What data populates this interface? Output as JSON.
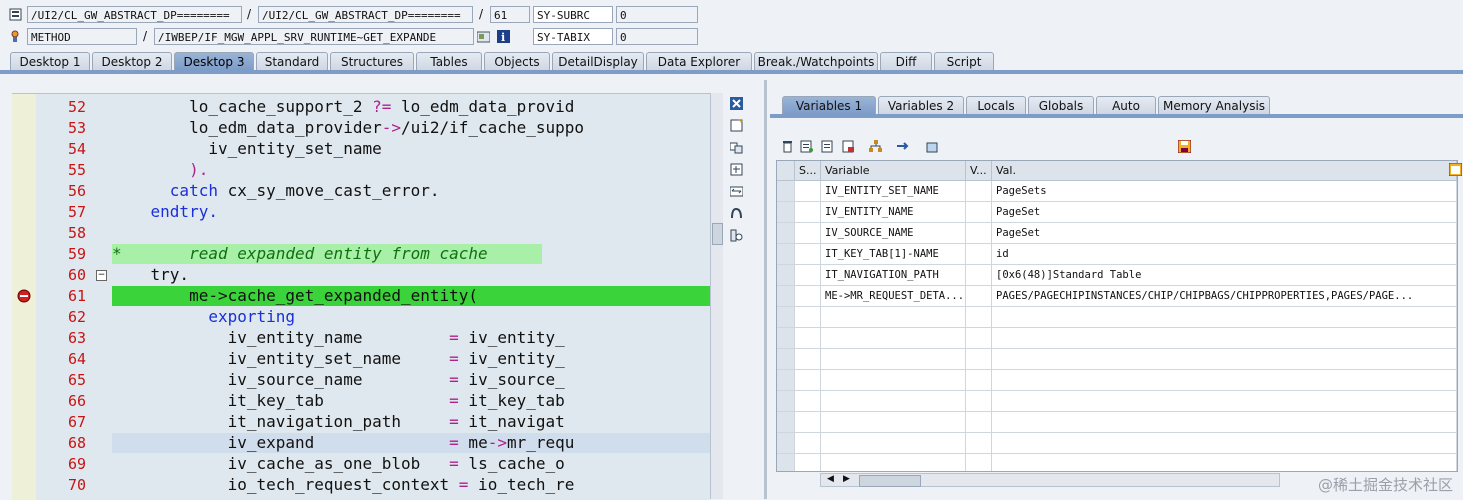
{
  "header": {
    "row1": {
      "program": "/UI2/CL_GW_ABSTRACT_DP========",
      "include": "/UI2/CL_GW_ABSTRACT_DP========",
      "line": "61",
      "sysvar": "SY-SUBRC",
      "sysval": "0"
    },
    "row2": {
      "type": "METHOD",
      "method": "/IWBEP/IF_MGW_APPL_SRV_RUNTIME~GET_EXPANDE",
      "sysvar": "SY-TABIX",
      "sysval": "0"
    },
    "separator": "/"
  },
  "tabs": [
    "Desktop 1",
    "Desktop 2",
    "Desktop 3",
    "Standard",
    "Structures",
    "Tables",
    "Objects",
    "DetailDisplay",
    "Data Explorer",
    "Break./Watchpoints",
    "Diff",
    "Script"
  ],
  "active_tab": "Desktop 3",
  "editor": {
    "lines": [
      {
        "n": "52",
        "parts": [
          [
            "",
            "        lo_cache_support_2 "
          ],
          [
            "op",
            "?="
          ],
          [
            "",
            " lo_edm_data_provid"
          ]
        ]
      },
      {
        "n": "53",
        "parts": [
          [
            "",
            "        lo_edm_data_provider"
          ],
          [
            "op",
            "->"
          ],
          [
            "",
            "/ui2/if_cache_suppo"
          ]
        ]
      },
      {
        "n": "54",
        "parts": [
          [
            "",
            "          iv_entity_set_name"
          ]
        ]
      },
      {
        "n": "55",
        "parts": [
          [
            "",
            "        "
          ],
          [
            "op",
            ")."
          ]
        ]
      },
      {
        "n": "56",
        "parts": [
          [
            "",
            "      "
          ],
          [
            "kw",
            "catch"
          ],
          [
            "",
            " cx_sy_move_cast_error."
          ]
        ]
      },
      {
        "n": "57",
        "parts": [
          [
            "",
            "    "
          ],
          [
            "kw",
            "endtry."
          ]
        ]
      },
      {
        "n": "58",
        "parts": [
          [
            "",
            ""
          ]
        ]
      },
      {
        "n": "59",
        "parts": [
          [
            "cmt",
            "*       read expanded entity from cache"
          ]
        ]
      },
      {
        "n": "60",
        "parts": [
          [
            "",
            "    try."
          ]
        ]
      },
      {
        "n": "61",
        "parts": [
          [
            "",
            "        me->cache_get_expanded_entity("
          ]
        ]
      },
      {
        "n": "62",
        "parts": [
          [
            "",
            "          "
          ],
          [
            "kw",
            "exporting"
          ]
        ]
      },
      {
        "n": "63",
        "parts": [
          [
            "",
            "            iv_entity_name         "
          ],
          [
            "op",
            "="
          ],
          [
            "",
            " iv_entity_"
          ]
        ]
      },
      {
        "n": "64",
        "parts": [
          [
            "",
            "            iv_entity_set_name     "
          ],
          [
            "op",
            "="
          ],
          [
            "",
            " iv_entity_"
          ]
        ]
      },
      {
        "n": "65",
        "parts": [
          [
            "",
            "            iv_source_name         "
          ],
          [
            "op",
            "="
          ],
          [
            "",
            " iv_source_"
          ]
        ]
      },
      {
        "n": "66",
        "parts": [
          [
            "",
            "            it_key_tab             "
          ],
          [
            "op",
            "="
          ],
          [
            "",
            " it_key_tab"
          ]
        ]
      },
      {
        "n": "67",
        "parts": [
          [
            "",
            "            it_navigation_path     "
          ],
          [
            "op",
            "="
          ],
          [
            "",
            " it_navigat"
          ]
        ]
      },
      {
        "n": "68",
        "parts": [
          [
            "",
            "            iv_expand              "
          ],
          [
            "op",
            "="
          ],
          [
            "",
            " me"
          ],
          [
            "op",
            "->"
          ],
          [
            "",
            "mr_requ"
          ]
        ]
      },
      {
        "n": "69",
        "parts": [
          [
            "",
            "            iv_cache_as_one_blob   "
          ],
          [
            "op",
            "="
          ],
          [
            "",
            " ls_cache_o"
          ]
        ]
      },
      {
        "n": "70",
        "parts": [
          [
            "",
            "            io_tech_request_context "
          ],
          [
            "op",
            "="
          ],
          [
            "",
            " io_tech_re"
          ]
        ]
      }
    ]
  },
  "right_tabs": [
    "Variables 1",
    "Variables 2",
    "Locals",
    "Globals",
    "Auto",
    "Memory Analysis"
  ],
  "active_right_tab": "Variables 1",
  "grid": {
    "headers": [
      "S...",
      "Variable",
      "V...",
      "Val."
    ],
    "rows": [
      {
        "variable": "IV_ENTITY_SET_NAME",
        "value": "PageSets"
      },
      {
        "variable": "IV_ENTITY_NAME",
        "value": "PageSet"
      },
      {
        "variable": "IV_SOURCE_NAME",
        "value": "PageSet"
      },
      {
        "variable": "IT_KEY_TAB[1]-NAME",
        "value": "id"
      },
      {
        "variable": "IT_NAVIGATION_PATH",
        "value": "[0x6(48)]Standard Table"
      },
      {
        "variable": "ME->MR_REQUEST_DETA...",
        "value": "PAGES/PAGECHIPINSTANCES/CHIP/CHIPBAGS/CHIPPROPERTIES,PAGES/PAGE..."
      }
    ],
    "empty_rows": 8
  },
  "watermark": "@稀土掘金技术社区",
  "colors": {
    "active_tab": "#7d9cc8",
    "current_line": "#3ad33a",
    "comment_bg": "#a8f0a8",
    "line_numbers": "#c81414",
    "keyword": "#1a2fd6"
  }
}
